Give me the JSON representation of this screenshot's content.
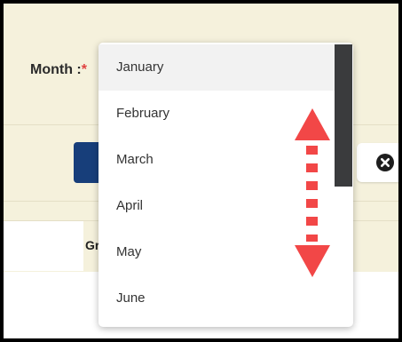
{
  "form": {
    "month_label": "Month :",
    "required_marker": "*"
  },
  "table": {
    "header_partial": "Gr"
  },
  "dropdown": {
    "options": [
      "January",
      "February",
      "March",
      "April",
      "May",
      "June"
    ],
    "selected": "January"
  },
  "icons": {
    "close": "close-circle-icon",
    "scroll_hint": "double-headed-arrow-icon"
  },
  "colors": {
    "panel_background": "#f5f1dc",
    "primary_button": "#173e7a",
    "arrow_red": "#f24747",
    "scroll_thumb": "#3a3b3d"
  }
}
